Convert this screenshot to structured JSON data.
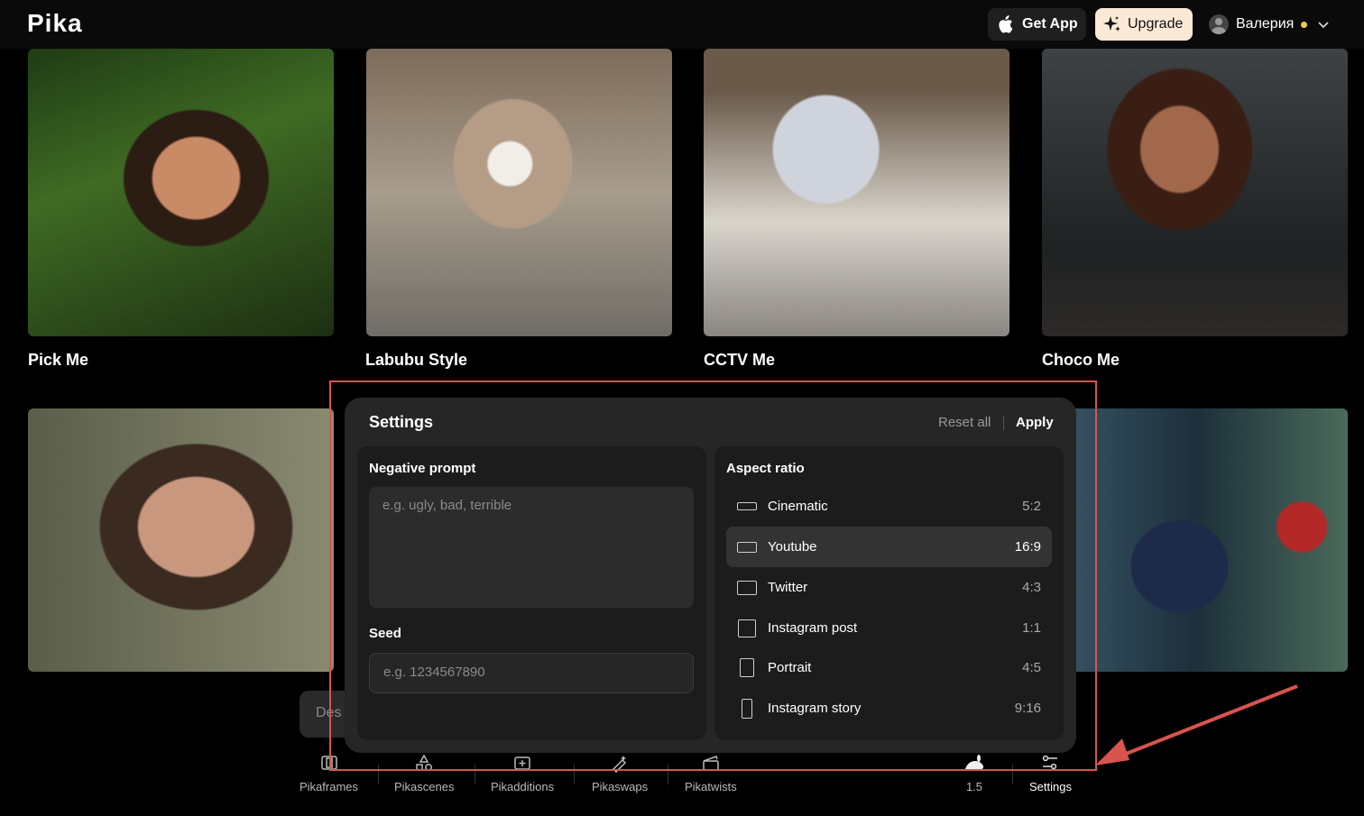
{
  "header": {
    "logo": "Pika",
    "get_app": "Get App",
    "upgrade": "Upgrade",
    "user_name": "Валерия"
  },
  "cards": [
    {
      "title": "Pick Me"
    },
    {
      "title": "Labubu Style"
    },
    {
      "title": "CCTV Me"
    },
    {
      "title": "Choco Me"
    }
  ],
  "prompt_bar": {
    "placeholder_partial": "Des"
  },
  "settings": {
    "title": "Settings",
    "reset_label": "Reset all",
    "apply_label": "Apply",
    "negative_prompt": {
      "label": "Negative prompt",
      "placeholder": "e.g. ugly, bad, terrible"
    },
    "seed": {
      "label": "Seed",
      "placeholder": "e.g. 1234567890"
    },
    "aspect_ratio": {
      "label": "Aspect ratio",
      "selected": "Youtube",
      "options": [
        {
          "name": "Cinematic",
          "ratio": "5:2"
        },
        {
          "name": "Youtube",
          "ratio": "16:9"
        },
        {
          "name": "Twitter",
          "ratio": "4:3"
        },
        {
          "name": "Instagram post",
          "ratio": "1:1"
        },
        {
          "name": "Portrait",
          "ratio": "4:5"
        },
        {
          "name": "Instagram story",
          "ratio": "9:16"
        }
      ]
    }
  },
  "toolbar": {
    "pikaframes": "Pikaframes",
    "pikascenes": "Pikascenes",
    "pikadditions": "Pikadditions",
    "pikaswaps": "Pikaswaps",
    "pikatwists": "Pikatwists",
    "model": "1.5",
    "settings": "Settings"
  },
  "colors": {
    "background": "#000000",
    "panel": "#262626",
    "upgrade_bg": "#fbe9d6",
    "annotation": "#d9534f",
    "status_dot": "#f2c94c"
  }
}
